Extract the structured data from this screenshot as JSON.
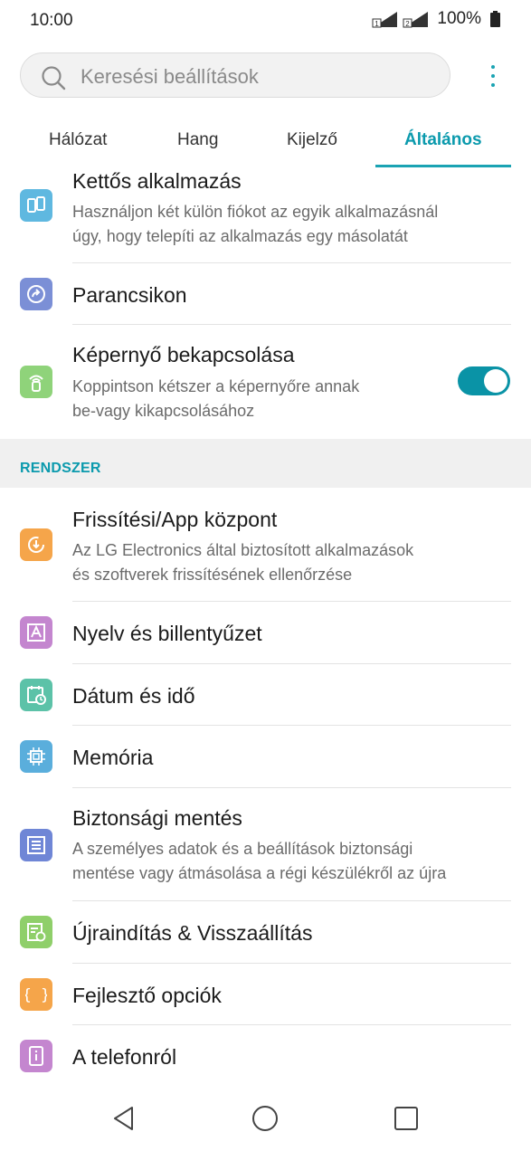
{
  "status_bar": {
    "time": "10:00",
    "battery": "100%",
    "sim1": "1",
    "sim2": "2"
  },
  "search": {
    "placeholder": "Keresési beállítások"
  },
  "tabs": [
    {
      "label": "Hálózat",
      "active": false
    },
    {
      "label": "Hang",
      "active": false
    },
    {
      "label": "Kijelző",
      "active": false
    },
    {
      "label": "Általános",
      "active": true
    }
  ],
  "items_top": [
    {
      "title": "Kettős alkalmazás",
      "subtitle_1": "Használjon két külön fiókot az egyik alkalmazásnál",
      "subtitle_2": "úgy, hogy telepíti az alkalmazás egy másolatát",
      "icon": "dual-app-icon",
      "color": "#5fb8e0"
    },
    {
      "title": "Parancsikon",
      "icon": "shortcut-icon",
      "color": "#7b8fd6"
    },
    {
      "title": "Képernyő bekapcsolása",
      "subtitle_1": "Koppintson kétszer a képernyőre annak",
      "subtitle_2": "be-vagy kikapcsolásához",
      "icon": "knock-on-icon",
      "color": "#8fd37a",
      "toggle_on": true
    }
  ],
  "section": {
    "label": "RENDSZER"
  },
  "items_system": [
    {
      "title": "Frissítési/App központ",
      "subtitle_1": "Az LG Electronics által biztosított alkalmazások",
      "subtitle_2": "és szoftverek frissítésének ellenőrzése",
      "icon": "update-center-icon",
      "color": "#f5a54a"
    },
    {
      "title": "Nyelv és billentyűzet",
      "icon": "language-icon",
      "color": "#c486cf"
    },
    {
      "title": "Dátum és idő",
      "icon": "calendar-clock-icon",
      "color": "#5cc2a8"
    },
    {
      "title": "Memória",
      "icon": "chip-icon",
      "color": "#5aaedc"
    },
    {
      "title": "Biztonsági mentés",
      "subtitle_1": "A személyes adatok és a beállítások biztonsági",
      "subtitle_2": "mentése vagy átmásolása a régi készülékről az újra",
      "icon": "backup-icon",
      "color": "#6f86d6"
    },
    {
      "title": "Újraindítás & Visszaállítás",
      "icon": "reset-icon",
      "color": "#8fcf6a"
    },
    {
      "title": "Fejlesztő opciók",
      "icon": "developer-braces-icon",
      "color": "#f5a54a"
    },
    {
      "title": "A telefonról",
      "icon": "about-phone-icon",
      "color": "#c486cf"
    }
  ],
  "nav": {
    "back": "back-icon",
    "home": "home-icon",
    "recents": "recents-icon"
  }
}
